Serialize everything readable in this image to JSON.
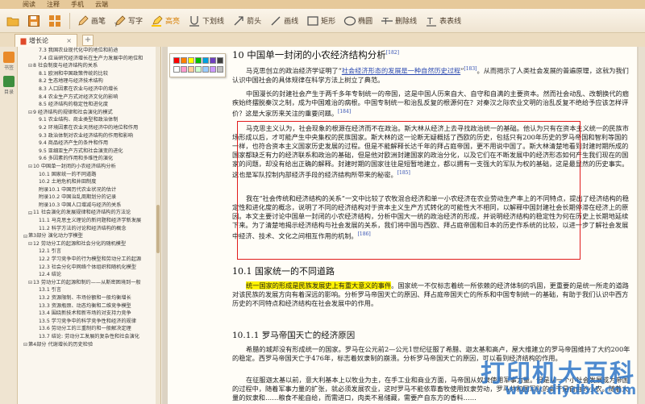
{
  "menu": [
    "阅读",
    "注释",
    "手机",
    "云端"
  ],
  "toolbar": [
    {
      "label": "",
      "icon": "folder-icon"
    },
    {
      "label": "",
      "icon": "save-icon"
    },
    {
      "label": "",
      "icon": "grid-icon"
    },
    {
      "label": "画笔",
      "icon": "pencil-icon"
    },
    {
      "label": "写字",
      "icon": "text-pen-icon"
    },
    {
      "label": "高亮",
      "icon": "highlighter-icon"
    },
    {
      "label": "下划线",
      "icon": "underline-icon"
    },
    {
      "label": "箭头",
      "icon": "arrow-icon"
    },
    {
      "label": "画线",
      "icon": "line-icon"
    },
    {
      "label": "矩形",
      "icon": "rectangle-icon"
    },
    {
      "label": "椭圆",
      "icon": "ellipse-icon"
    },
    {
      "label": "删除线",
      "icon": "strikethrough-icon"
    },
    {
      "label": "表表线",
      "icon": "table-line-icon"
    }
  ],
  "tab": {
    "title": "增长论"
  },
  "side_strip": [
    {
      "label": "书签"
    },
    {
      "label": "目录"
    }
  ],
  "toc": [
    {
      "text": "7.3 我国农业现代化中的地位和前途",
      "level": 2
    },
    {
      "text": "7.4 应当研究经济增长在生产力发展中的地位和",
      "level": 2
    },
    {
      "text": "8 社会制度与经济结构的关系",
      "level": 1
    },
    {
      "text": "8.1 欧洲和中国政策传统的比较",
      "level": 2
    },
    {
      "text": "8.2 生态地理与经济技术结构",
      "level": 2
    },
    {
      "text": "8.3 人口因素在农业与经济中的增长",
      "level": 2
    },
    {
      "text": "8.4 农业生产方式对经济文化的影响",
      "level": 2
    },
    {
      "text": "8.5 经济结构的稳定性和进化度",
      "level": 2
    },
    {
      "text": "9 经济结构的规律和社会演化的模式",
      "level": 1
    },
    {
      "text": "9.1 农业结构、商业类型和政治体制",
      "level": 2
    },
    {
      "text": "9.2 环境因素在农业天然经济中的地位和作用",
      "level": 2
    },
    {
      "text": "9.3 政治体制对农业经济结构的作用和影响",
      "level": 2
    },
    {
      "text": "9.4 商品经济产生的条件和作用",
      "level": 2
    },
    {
      "text": "9.5 亚细亚生产方式和社会演变的进化",
      "level": 2
    },
    {
      "text": "9.6 多因素的作用和多维性的演化",
      "level": 2
    },
    {
      "text": "10 中国单一封闭的小农经济结构分析",
      "level": 1
    },
    {
      "text": "10.1 国家统一的不同道路",
      "level": 2
    },
    {
      "text": "10.2 土地危机和井田制度",
      "level": 2
    },
    {
      "text": "附录10.1 中国历代农业状况的估计",
      "level": 2
    },
    {
      "text": "附录10.2 中国治乱周期划分的记录",
      "level": 2
    },
    {
      "text": "附录10.3 中国人口增减与经济的关系",
      "level": 2
    },
    {
      "text": "11 社会演化的发展规律和经济结构的方法论",
      "level": 1
    },
    {
      "text": "11.1 马克思主义理论的新问题和经济学新发展",
      "level": 2
    },
    {
      "text": "11.2 科学方法的讨论和经济结构的概念",
      "level": 2
    },
    {
      "text": "第3部分 演化动力学模型",
      "level": 0
    },
    {
      "text": "12 劳动分工的起源和社会分化的随机模型",
      "level": 1
    },
    {
      "text": "12.1 引言",
      "level": 2
    },
    {
      "text": "12.2 学习竞争中的行为模型和劳动分工的起源",
      "level": 2
    },
    {
      "text": "12.3 社会分化中网络个体组织和随机化模型",
      "level": 2
    },
    {
      "text": "12.4 结论",
      "level": 2
    },
    {
      "text": "13 劳动分工的起源和制约——从斯密困境到一般",
      "level": 1
    },
    {
      "text": "13.1 引言",
      "level": 2
    },
    {
      "text": "13.2 资源限制、市场份额和一般均衡增长",
      "level": 2
    },
    {
      "text": "13.3 资源瓶颈、动态均衡和二维竞争模型",
      "level": 2
    },
    {
      "text": "13.4 围绕新技术和新市场的对支持力竞争",
      "level": 2
    },
    {
      "text": "13.5 学习竞争中的科学竞争性和经济的规律",
      "level": 2
    },
    {
      "text": "13.6 劳动分工的三重制约和一般解决定理",
      "level": 2
    },
    {
      "text": "13.7 结论: 劳动分工发展的复杂性和社会演化",
      "level": 2
    },
    {
      "text": "第4部分 代谢增长的历史检验",
      "level": 0
    }
  ],
  "doc": {
    "h1": "10 中国单一封闭的小农经济结构分析",
    "h1_ref": "[182]",
    "p1a": "马克思创立的政治经济学证明了“",
    "p1_u": "社会经济形态的发展是一种自然历史过程",
    "p1b": "”",
    "p1_ref": "[183]",
    "p1c": "。从而揭示了人类社会发展的普遍原理，这就为我们认识中国社会的具体规律在科学方法上树立了典范。",
    "p2": "中国漫长的封建社会产生于两千多年专制统一的帝国，这是中国人历来自大、自守和自满的主要资本。然而社会动乱、改朝换代的痼疾始终摆脱秦汉之制，成为中国难治的病根。中国专制统一和治乱反复的根源何在？对秦汉之际农业文明的治乱反复不绝给予应该怎样评价？这是大家历来关注的重要问题。",
    "p2_ref": "[184]",
    "p3": "马克思主义认为，社会现象的根源在经济而不在政治。斯大林从经济上去寻找政治统一的基础。他认为只有在资本主义统一的民族市场形成以后，才可能产生中央集权的民族国家。斯大林的这一论断无疑概括了西欧的历史，包括只有200年历史的罗马帝国和智利等国的一样，也符合资本主义国家历史发展的过程。但是不能解释长达千年的拜占庭帝国，更不用说中国了。斯大林清楚地看到封建时期所成的国家都缺乏有力的经济联系和政治的基础，但是他对欧洲封建国家的政治分化，以及它们在不断发展中的经济形态如何产生我们现在的国家的问题，却没有给出正确的解释。封建时期的国家往往是短暂地建立，都以拥有一支强大的军队为权的基础，这是最显然的历史事实。这也是军队控制内部经济手段的经济结构所带来的秘密。",
    "p3_ref": "[185]",
    "p4": "我在“社会传统和经济结构的关系”一文中比较了农牧混合经济和单一小农经济在农业劳动生产率上的不同特点，提出了经济结构的稳定性和进化度的概念，说明了不同的经济结构对于资本主义生产方式转化的可能性大不相同，以解释中国封建社会长期停滞在经济上的原因。本文主要讨论中国单一封闭的小农经济结构，分析中国大一统的政治经济的形成，并说明经济结构的稳定性为何在历史上长期地延续下来。为了清楚地揭示经济结构与社会发展的关系，我们将中国与西欧、拜占庭帝国和日本的历史作系统的比较，以进一步了解社会发展中经济、技术、文化之间相互作用的机制。",
    "p4_ref": "[186]",
    "h2": "10.1 国家统一的不同道路",
    "p5_hl": "统一国家的形成是民族发展史上有重大意义的事件",
    "p5": "。国家统一不仅标志着统一所依赖的经济体制的巩固，更重要的是统一所走的道路对该民族的发展方向有着深远的影响。分析罗马帝国天亡的原因、拜占庭帝国天亡的所系和中国专制统一的基础，有助于我们认识中西方历史的不同特点和经济结构在社会发展中的作用。",
    "h3": "10.1.1 罗马帝国天亡的经济原因",
    "p6": "希腊的城邦没有形成统一的国家。罗马在公元前2—公元1世纪征服了希腊、迦太基和高卢，屋大维建立的罗马帝国维持了大约200年的稳定。西罗马帝国天亡于476年，标志着奴隶制的崩溃。分析罗马帝国天亡的原因，可以看到经济结构的作用。",
    "p7": "在征服迦太基以前，意大利基本上以牧业为主，在手工业和商业方面，马帝国从奴隶使用军事力量。但是从一个小社会发展成为帝国的过程中，随着军事力量的扩张，就必须发展农业，这时罗马不能依靠畜牧使用奴隶劳动，罗马共和国军队的骨干是自由的小农。随着大量的奴隶和……粮食不能自给，而需进口，肉类不易储藏，需要产自东方的香料……"
  },
  "watermark": {
    "text": "打印机大百科",
    "url": "www.diydbk.com"
  },
  "picker_colors": [
    "#ff0000",
    "#ff7f00",
    "#ffff00",
    "#00c000",
    "#00a0e0",
    "#7040c0",
    "#404040",
    "#ffffff",
    "#ff99cc",
    "#ffcc99",
    "#ccffcc",
    "#99ccff",
    "#cc99ff",
    "#c0c0c0"
  ]
}
